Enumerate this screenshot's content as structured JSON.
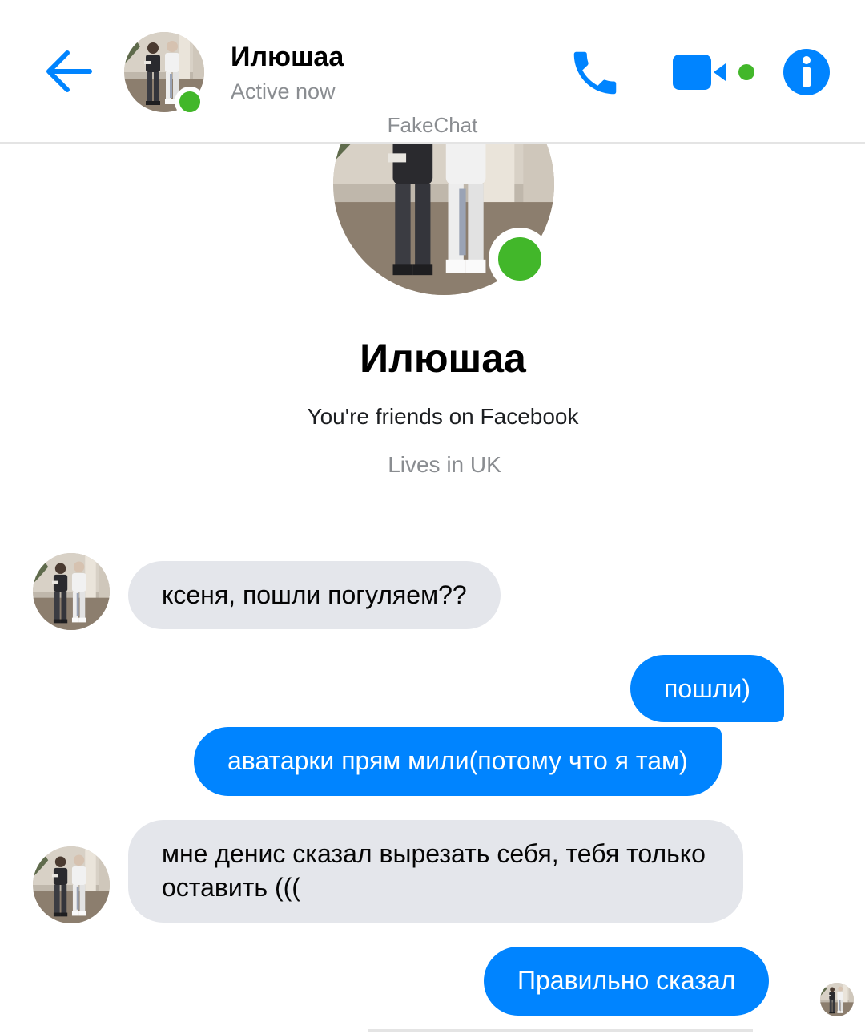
{
  "header": {
    "contact_name": "Илюшаа",
    "status": "Active now",
    "watermark": "FakeChat"
  },
  "icons": {
    "back": "back-arrow-icon",
    "call": "phone-icon",
    "video": "video-camera-icon",
    "info": "info-icon"
  },
  "profile": {
    "name": "Илюшаа",
    "friends_line": "You're friends on Facebook",
    "location_line": "Lives in UK"
  },
  "messages": [
    {
      "direction": "incoming",
      "text": "ксеня, пошли погуляем??"
    },
    {
      "direction": "outgoing",
      "text": "пошли)"
    },
    {
      "direction": "outgoing",
      "text": "аватарки прям мили(потому что я там)"
    },
    {
      "direction": "incoming",
      "text": "мне денис сказал вырезать себя, тебя только оставить ((("
    },
    {
      "direction": "outgoing",
      "text": "Правильно сказал"
    }
  ],
  "colors": {
    "accent": "#0084ff",
    "online": "#42b72a",
    "incoming_bubble": "#e4e6eb",
    "outgoing_bubble": "#0084ff",
    "secondary_text": "#8a8d91"
  }
}
